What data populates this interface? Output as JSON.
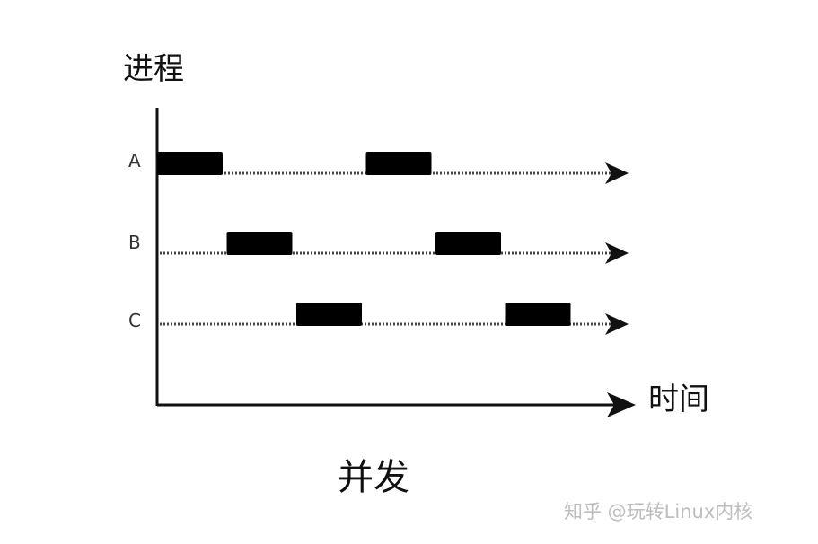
{
  "diagram": {
    "y_axis_title": "进程",
    "x_axis_title": "时间",
    "caption": "并发",
    "watermark": "知乎 @玩转Linux内核",
    "colors": {
      "axis": "#111111",
      "block": "#000000",
      "dotted_line": "#444444",
      "watermark": "#bdbdbd"
    }
  },
  "chart_data": {
    "type": "gantt",
    "title": "",
    "caption": "并发",
    "xlabel": "时间",
    "ylabel": "进程",
    "time_slots": 6,
    "processes": [
      {
        "name": "A",
        "running_slots": [
          1,
          4
        ]
      },
      {
        "name": "B",
        "running_slots": [
          2,
          5
        ]
      },
      {
        "name": "C",
        "running_slots": [
          3,
          6
        ]
      }
    ]
  }
}
